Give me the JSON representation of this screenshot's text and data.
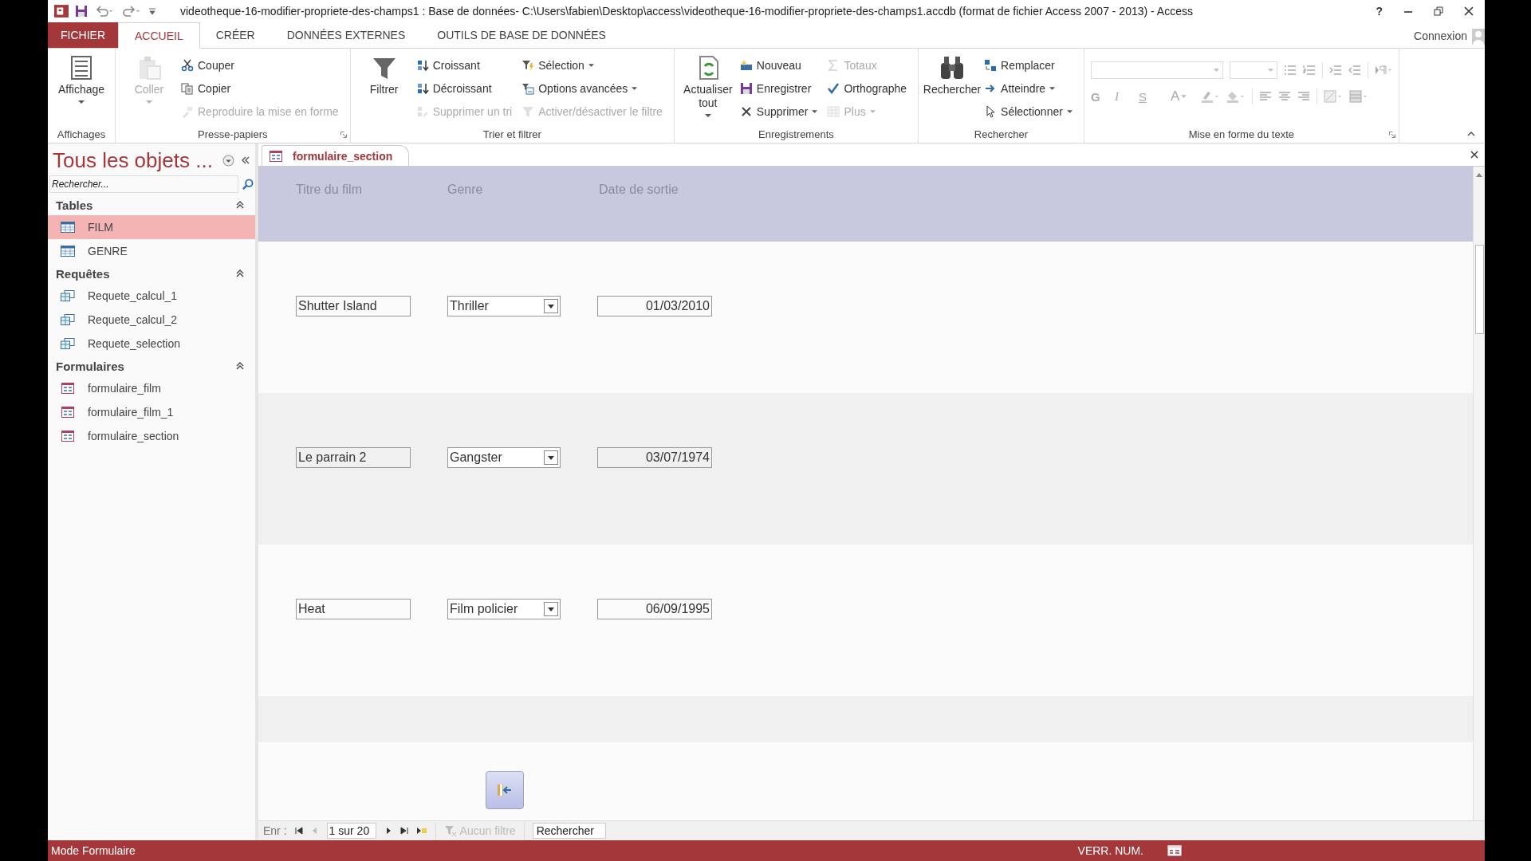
{
  "window": {
    "title": "videotheque-16-modifier-propriete-des-champs1 : Base de données- C:\\Users\\fabien\\Desktop\\access\\videotheque-16-modifier-propriete-des-champs1.accdb (format de fichier Access 2007 - 2013) - Access",
    "help": "?"
  },
  "ribbon_tabs": [
    {
      "label": "FICHIER",
      "kind": "file",
      "selected": false
    },
    {
      "label": "ACCUEIL",
      "kind": "tab",
      "selected": true
    },
    {
      "label": "CRÉER",
      "kind": "tab",
      "selected": false
    },
    {
      "label": "DONNÉES EXTERNES",
      "kind": "tab",
      "selected": false
    },
    {
      "label": "OUTILS DE BASE DE DONNÉES",
      "kind": "tab",
      "selected": false
    }
  ],
  "account": "Connexion",
  "ribbon_groups": [
    {
      "label": "Affichages",
      "launcher": false,
      "columns": [
        {
          "kind": "large",
          "items": [
            {
              "label": "Affichage",
              "disabled": false,
              "dropdown": true
            }
          ]
        }
      ]
    },
    {
      "label": "Presse-papiers",
      "launcher": true,
      "columns": [
        {
          "kind": "large",
          "items": [
            {
              "label": "Coller",
              "disabled": true,
              "dropdown": true
            }
          ]
        },
        {
          "kind": "stack",
          "items": [
            {
              "label": "Couper",
              "disabled": false,
              "dropdown": false
            },
            {
              "label": "Copier",
              "disabled": false,
              "dropdown": false
            },
            {
              "label": "Reproduire la mise en forme",
              "disabled": true,
              "dropdown": false
            }
          ]
        }
      ]
    },
    {
      "label": "Trier et filtrer",
      "launcher": false,
      "columns": [
        {
          "kind": "large",
          "items": [
            {
              "label": "Filtrer",
              "disabled": false,
              "dropdown": false
            }
          ]
        },
        {
          "kind": "stack",
          "items": [
            {
              "label": "Croissant",
              "disabled": false,
              "dropdown": false
            },
            {
              "label": "Décroissant",
              "disabled": false,
              "dropdown": false
            },
            {
              "label": "Supprimer un tri",
              "disabled": true,
              "dropdown": false
            }
          ]
        },
        {
          "kind": "stack",
          "items": [
            {
              "label": "Sélection",
              "disabled": false,
              "dropdown": true
            },
            {
              "label": "Options avancées",
              "disabled": false,
              "dropdown": true
            },
            {
              "label": "Activer/désactiver le filtre",
              "disabled": true,
              "dropdown": false
            }
          ]
        }
      ]
    },
    {
      "label": "Enregistrements",
      "launcher": false,
      "columns": [
        {
          "kind": "large",
          "items": [
            {
              "label": "Actualiser tout",
              "disabled": false,
              "dropdown": true
            }
          ]
        },
        {
          "kind": "stack",
          "items": [
            {
              "label": "Nouveau",
              "disabled": false,
              "dropdown": false
            },
            {
              "label": "Enregistrer",
              "disabled": false,
              "dropdown": false
            },
            {
              "label": "Supprimer",
              "disabled": false,
              "dropdown": true
            }
          ]
        },
        {
          "kind": "stack",
          "items": [
            {
              "label": "Totaux",
              "disabled": true,
              "dropdown": false
            },
            {
              "label": "Orthographe",
              "disabled": false,
              "dropdown": false
            },
            {
              "label": "Plus",
              "disabled": true,
              "dropdown": true
            }
          ]
        }
      ]
    },
    {
      "label": "Rechercher",
      "launcher": false,
      "columns": [
        {
          "kind": "large",
          "items": [
            {
              "label": "Rechercher",
              "disabled": false,
              "dropdown": false
            }
          ]
        },
        {
          "kind": "stack",
          "items": [
            {
              "label": "Remplacer",
              "disabled": false,
              "dropdown": false
            },
            {
              "label": "Atteindre",
              "disabled": false,
              "dropdown": true
            },
            {
              "label": "Sélectionner",
              "disabled": false,
              "dropdown": true
            }
          ]
        }
      ]
    },
    {
      "label": "Mise en forme du texte",
      "launcher": true,
      "columns": [
        {
          "kind": "format",
          "items": [
            {
              "label": "G",
              "disabled": true,
              "dropdown": false
            },
            {
              "label": "I",
              "disabled": true,
              "dropdown": false
            },
            {
              "label": "S",
              "disabled": true,
              "dropdown": false
            },
            {
              "label": "A",
              "disabled": true,
              "dropdown": true
            }
          ]
        }
      ]
    }
  ],
  "nav_pane": {
    "title": "Tous les objets ...",
    "search": {
      "placeholder": "Rechercher..."
    },
    "sections": [
      {
        "label": "Tables",
        "expanded": true,
        "items": [
          {
            "label": "FILM",
            "kind": "table",
            "selected": true
          },
          {
            "label": "GENRE",
            "kind": "table",
            "selected": false
          }
        ]
      },
      {
        "label": "Requêtes",
        "expanded": true,
        "items": [
          {
            "label": "Requete_calcul_1",
            "kind": "query",
            "selected": false
          },
          {
            "label": "Requete_calcul_2",
            "kind": "query",
            "selected": false
          },
          {
            "label": "Requete_selection",
            "kind": "query",
            "selected": false
          }
        ]
      },
      {
        "label": "Formulaires",
        "expanded": true,
        "items": [
          {
            "label": "formulaire_film",
            "kind": "form",
            "selected": false
          },
          {
            "label": "formulaire_film_1",
            "kind": "form",
            "selected": false
          },
          {
            "label": "formulaire_section",
            "kind": "form",
            "selected": false
          }
        ]
      }
    ]
  },
  "document_tabs": [
    {
      "label": "formulaire_section",
      "selected": true
    }
  ],
  "form": {
    "columns": [
      "Titre du film",
      "Genre",
      "Date de sortie"
    ],
    "records": [
      {
        "title": "Shutter Island",
        "genre": "Thriller",
        "date": "01/03/2010"
      },
      {
        "title": "Le parrain 2",
        "genre": "Gangster",
        "date": "03/07/1974"
      },
      {
        "title": "Heat",
        "genre": "Film policier",
        "date": "06/09/1995"
      }
    ]
  },
  "record_nav": {
    "label": "Enr :",
    "position": "1 sur 20",
    "filter": {
      "label": "Aucun filtre",
      "disabled": true
    },
    "search": {
      "placeholder": "Rechercher"
    }
  },
  "status_bar": {
    "mode": "Mode Formulaire",
    "indicators": [
      "VERR. NUM."
    ]
  }
}
